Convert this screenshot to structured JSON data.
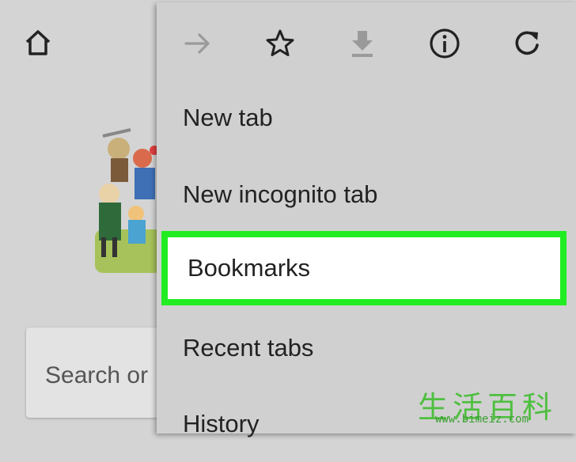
{
  "icons": {
    "home": "home-icon",
    "forward": "arrow-forward-icon",
    "bookmark_star": "star-icon",
    "download": "download-icon",
    "info": "info-icon",
    "reload": "reload-icon"
  },
  "search": {
    "placeholder_visible": "Search or"
  },
  "menu": {
    "items": [
      {
        "label": "New tab"
      },
      {
        "label": "New incognito tab"
      },
      {
        "label": "Bookmarks",
        "highlighted": true
      },
      {
        "label": "Recent tabs"
      },
      {
        "label": "History"
      }
    ]
  },
  "colors": {
    "highlight": "#22ec22",
    "menu_bg": "#d0d0d0",
    "page_bg": "#d4d4d4"
  },
  "watermark": {
    "chinese": "生活百科",
    "url": "www.bimeiz.com"
  }
}
